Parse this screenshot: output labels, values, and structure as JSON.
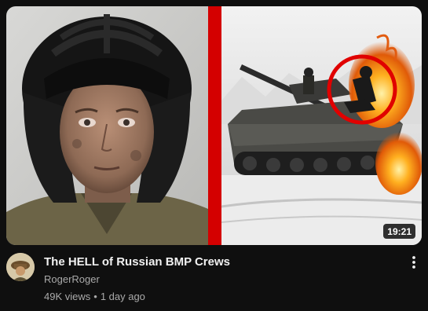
{
  "video": {
    "title": "The HELL of Russian BMP Crews",
    "duration": "19:21",
    "channel": "RogerRoger",
    "views": "49K views",
    "separator": "•",
    "age": "1 day ago"
  },
  "icons": {
    "menu": "more-vert-icon"
  },
  "colors": {
    "background": "#0f0f0f",
    "title_text": "#f1f1f1",
    "secondary_text": "#aaaaaa",
    "thumbnail_divider": "#d40000",
    "highlight_circle": "#e00000"
  }
}
